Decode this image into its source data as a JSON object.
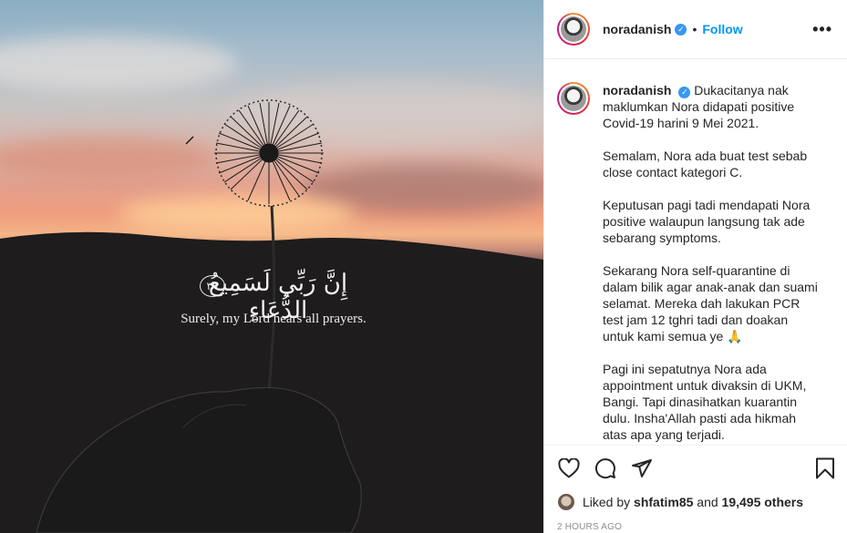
{
  "photo": {
    "arabic_verse": "إِنَّ رَبِّي لَسَمِيعُ الدُّعَاءِ",
    "ayah_number": "٣٩",
    "english_verse": "Surely, my Lord hears all prayers."
  },
  "header": {
    "username": "noradanish",
    "separator": "•",
    "follow_label": "Follow",
    "more_label": "•••"
  },
  "caption": {
    "username": "noradanish",
    "paragraphs": [
      "Dukacitanya nak maklumkan Nora didapati positive Covid-19 harini 9 Mei 2021.",
      "Semalam, Nora ada buat test sebab close contact kategori C.",
      "Keputusan pagi tadi mendapati Nora positive walaupun langsung tak ade sebarang symptoms.",
      "Sekarang Nora self-quarantine di dalam bilik agar anak-anak dan suami selamat. Mereka dah lakukan PCR test jam 12 tghri tadi dan doakan untuk kami semua ye 🙏",
      "Pagi ini sepatutnya Nora ada appointment untuk divaksin di UKM, Bangi. Tapi dinasihatkan kuarantin dulu. Insha'Allah pasti ada hikmah atas apa yang terjadi."
    ]
  },
  "actions": {
    "icons": [
      "heart-icon",
      "comment-icon",
      "share-icon",
      "bookmark-icon"
    ]
  },
  "likes": {
    "prefix": "Liked by",
    "user": "shfatim85",
    "connector": "and",
    "others": "19,495 others"
  },
  "timestamp": "2 HOURS AGO",
  "colors": {
    "accent": "#0095f6",
    "verified": "#3897f0",
    "text": "#262626",
    "muted": "#8e8e8e"
  }
}
